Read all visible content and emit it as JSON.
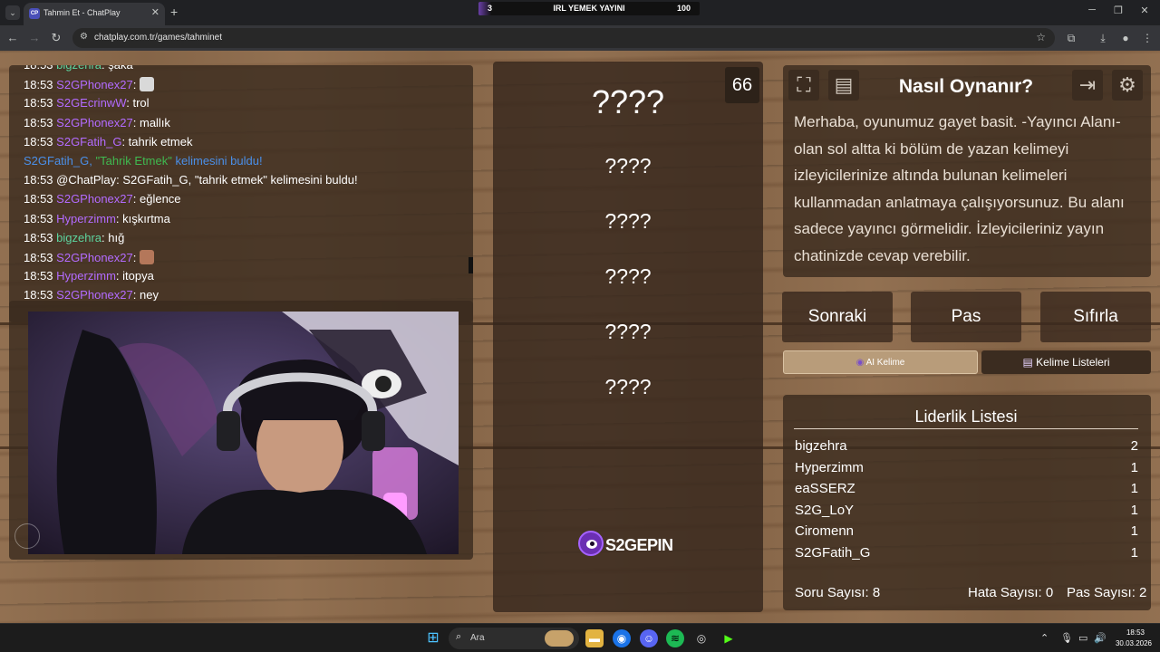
{
  "browser": {
    "tab_title": "Tahmin Et - ChatPlay",
    "tab_favicon": "CP",
    "url": "chatplay.com.tr/games/tahminet",
    "stream_bar": {
      "left": "3",
      "center": "IRL YEMEK YAYINI",
      "right": "100"
    }
  },
  "chat": {
    "messages": [
      {
        "time": "18:53",
        "user": "bigzehra",
        "user_color": "#5dd39e",
        "text": "şaka"
      },
      {
        "time": "18:53",
        "user": "S2GPhonex27",
        "user_color": "#b36bff",
        "text": "",
        "emote": true
      },
      {
        "time": "18:53",
        "user": "S2GEcrinwW",
        "user_color": "#b36bff",
        "text": "trol"
      },
      {
        "time": "18:53",
        "user": "S2GPhonex27",
        "user_color": "#b36bff",
        "text": "mallık"
      },
      {
        "time": "18:53",
        "user": "S2GFatih_G",
        "user_color": "#b36bff",
        "text": "tahrik etmek"
      },
      {
        "system": true,
        "user": "S2GFatih_G",
        "word": "\"Tahrik Etmek\"",
        "text": " kelimesini buldu!"
      },
      {
        "time": "18:53",
        "user": "@ChatPlay",
        "user_color": "#ffffff",
        "text": "S2GFatih_G, \"tahrik etmek\" kelimesini buldu!"
      },
      {
        "time": "18:53",
        "user": "S2GPhonex27",
        "user_color": "#b36bff",
        "text": "eğlence"
      },
      {
        "time": "18:53",
        "user": "Hyperzimm",
        "user_color": "#b36bff",
        "text": "kışkırtma"
      },
      {
        "time": "18:53",
        "user": "bigzehra",
        "user_color": "#5dd39e",
        "text": "hığ"
      },
      {
        "time": "18:53",
        "user": "S2GPhonex27",
        "user_color": "#b36bff",
        "text": "",
        "emote": true
      },
      {
        "time": "18:53",
        "user": "Hyperzimm",
        "user_color": "#b36bff",
        "text": "itopya"
      },
      {
        "time": "18:53",
        "user": "S2GPhonex27",
        "user_color": "#b36bff",
        "text": "ney"
      }
    ]
  },
  "game": {
    "timer": "66",
    "words": [
      "????",
      "????",
      "????",
      "????",
      "????",
      "????"
    ],
    "logo_text": "S2GEPIN"
  },
  "howto": {
    "title": "Nasıl Oynanır?",
    "text": "Merhaba, oyunumuz gayet basit. -Yayıncı Alanı- olan sol altta ki bölüm de yazan kelimeyi izleyicilerinize altında bulunan kelimeleri kullanmadan anlatmaya çalışıyorsunuz. Bu alanı sadece yayıncı görmelidir. İzleyicileriniz yayın chatinizde cevap verebilir."
  },
  "actions": {
    "next": "Sonraki",
    "pass": "Pas",
    "reset": "Sıfırla"
  },
  "modes": {
    "ai_icon": "◉",
    "ai": "AI Kelime",
    "list_icon": "▤",
    "list": "Kelime Listeleri"
  },
  "leaderboard": {
    "title": "Liderlik Listesi",
    "rows": [
      {
        "name": "bigzehra",
        "score": "2"
      },
      {
        "name": "Hyperzimm",
        "score": "1"
      },
      {
        "name": "eaSSERZ",
        "score": "1"
      },
      {
        "name": "S2G_LoY",
        "score": "1"
      },
      {
        "name": "Ciromenn",
        "score": "1"
      },
      {
        "name": "S2GFatih_G",
        "score": "1"
      }
    ]
  },
  "stats": {
    "questions": "Soru Sayısı: 8",
    "errors": "Hata Sayısı: 0",
    "passes": "Pas Sayısı: 2"
  },
  "taskbar": {
    "search_placeholder": "Ara",
    "time": "18:53",
    "date": "30.03.2026"
  }
}
